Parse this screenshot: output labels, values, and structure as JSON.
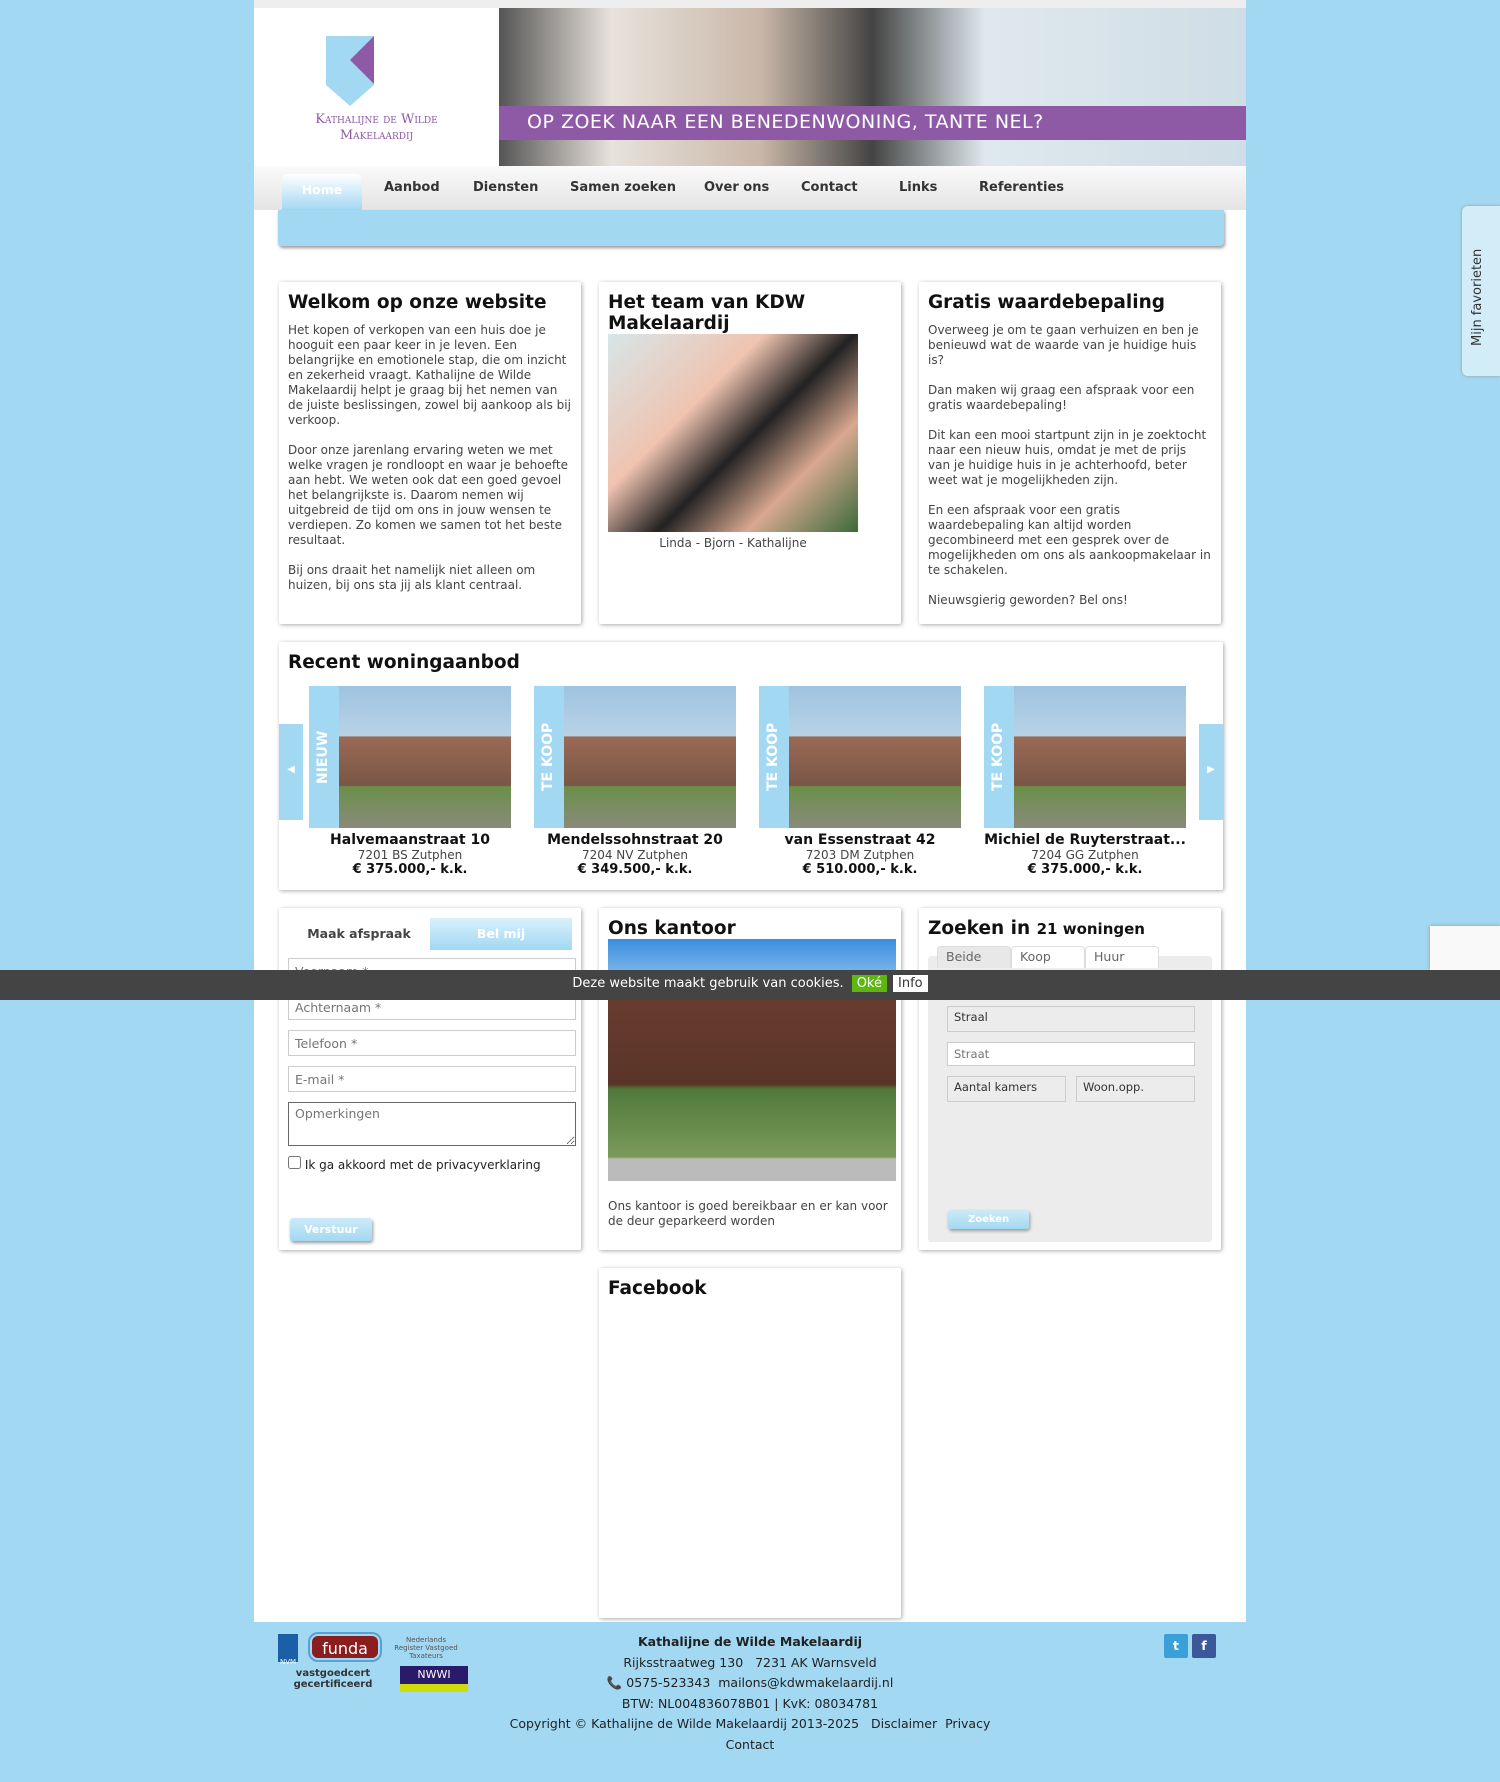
{
  "brand": {
    "name_line1": "Kathalijne de Wilde",
    "name_line2": "Makelaardij",
    "banner_text": "OP ZOEK NAAR EEN BENEDENWONING, TANTE NEL?",
    "accent": "#8e5aa5",
    "light_blue": "#a3d8f2"
  },
  "nav": [
    "Home",
    "Aanbod",
    "Diensten",
    "Samen zoeken",
    "Over ons",
    "Contact",
    "Links",
    "Referenties"
  ],
  "welcome": {
    "title": "Welkom op onze website",
    "paragraphs": [
      "Het kopen of verkopen van een huis doe je hooguit een paar keer in je leven. Een belangrijke en emotionele stap, die om inzicht en zekerheid vraagt. Kathalijne de Wilde Makelaardij helpt je graag bij het nemen van de juiste beslissingen, zowel bij aankoop als bij verkoop.",
      "Door onze jarenlang ervaring weten we met welke vragen je rondloopt en waar je behoefte aan hebt. We weten ook dat een goed gevoel het belangrijkste is. Daarom nemen wij uitgebreid de tijd om ons in jouw wensen te verdiepen. Zo komen we samen tot het beste resultaat.",
      "Bij ons draait het namelijk niet alleen om huizen, bij ons sta jij als klant centraal."
    ]
  },
  "team": {
    "title": "Het team van KDW Makelaardij",
    "caption": "Linda - Bjorn - Kathalijne"
  },
  "valuation": {
    "title": "Gratis waardebepaling",
    "paragraphs": [
      "Overweeg je om te gaan verhuizen en ben je benieuwd wat de waarde van je huidige huis is?",
      "Dan maken wij graag een afspraak voor een gratis waardebepaling!",
      "Dit kan een mooi startpunt zijn in je zoektocht naar een nieuw huis, omdat je met de prijs van je huidige huis in je achterhoofd, beter weet wat je mogelijkheden zijn.",
      "En een afspraak voor een gratis waardebepaling kan altijd worden gecombineerd met een gesprek over de mogelijkheden om ons als aankoopmakelaar in te schakelen.",
      "Nieuwsgierig geworden? Bel ons!"
    ]
  },
  "recent": {
    "title": "Recent woningaanbod",
    "prev": "◀",
    "next": "▶",
    "items": [
      {
        "label": "NIEUW",
        "street": "Halvemaanstraat 10",
        "city": "7201 BS Zutphen",
        "price": "€ 375.000,- k.k."
      },
      {
        "label": "TE KOOP",
        "street": "Mendelssohnstraat 20",
        "city": "7204 NV Zutphen",
        "price": "€ 349.500,- k.k."
      },
      {
        "label": "TE KOOP",
        "street": "van Essenstraat 42",
        "city": "7203 DM Zutphen",
        "price": "€ 510.000,- k.k."
      },
      {
        "label": "TE KOOP",
        "street": "Michiel de Ruyterstraat...",
        "city": "7204 GG Zutphen",
        "price": "€ 375.000,- k.k."
      }
    ]
  },
  "form": {
    "tab1": "Maak afspraak",
    "tab2": "Bel mij",
    "first": "Voornaam *",
    "last": "Achternaam *",
    "phone": "Telefoon *",
    "email": "E-mail *",
    "remarks": "Opmerkingen",
    "agree": "Ik ga akkoord met de",
    "privacy": "privacyverklaring",
    "submit": "Verstuur"
  },
  "office": {
    "title": "Ons kantoor",
    "text": "Ons kantoor is goed bereikbaar en er kan voor de deur geparkeerd worden"
  },
  "search": {
    "title": "Zoeken in",
    "count": "21 woningen",
    "tabs": [
      "Beide",
      "Koop",
      "Huur"
    ],
    "street_select": "Straal",
    "street_input": "Straat",
    "rooms": "Aantal kamers",
    "area": "Woon.opp.",
    "button": "Zoeken"
  },
  "facebook": {
    "title": "Facebook"
  },
  "cookie": {
    "text": "Deze website maakt gebruik van cookies.",
    "ok": "Oké",
    "info": "Info"
  },
  "favorites": "Mijn favorieten",
  "footer": {
    "company": "Kathalijne de Wilde Makelaardij",
    "address": "Rijksstraatweg 130   7231 AK Warnsveld",
    "phone": "0575-523343",
    "email": "mailons@kdwmakelaardij.nl",
    "btw": "BTW: NL004836078B01 | KvK: 08034781",
    "copyright": "Copyright © Kathalijne de Wilde Makelaardij 2013-2025",
    "disclaimer": "Disclaimer",
    "privacy": "Privacy",
    "contact": "Contact",
    "logos": [
      "NVM",
      "funda",
      "Nederlands Register Vastgoed Taxateurs",
      "vastgoedcert gecertificeerd",
      "NWWI"
    ]
  }
}
